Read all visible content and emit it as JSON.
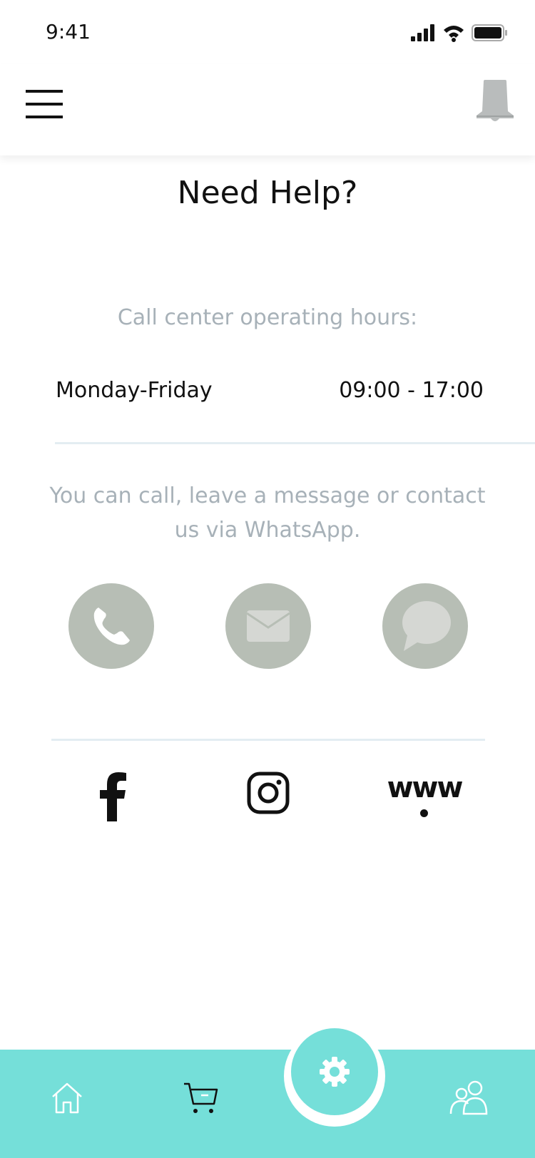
{
  "status_bar": {
    "time": "9:41"
  },
  "header": {
    "menu_icon": "hamburger-menu-icon",
    "bell_icon": "bell-icon"
  },
  "page": {
    "title": "Need Help?",
    "hours_caption": "Call center operating hours:",
    "hours": {
      "days": "Monday-Friday",
      "time": "09:00 - 17:00"
    },
    "contact_note": "You can call, leave a message or contact us via WhatsApp."
  },
  "contact_buttons": [
    {
      "icon": "phone-icon"
    },
    {
      "icon": "mail-icon"
    },
    {
      "icon": "chat-bubble-icon"
    }
  ],
  "social": {
    "facebook_icon": "facebook-icon",
    "instagram_icon": "instagram-icon",
    "www_label": "www"
  },
  "bottom_nav": {
    "items": [
      {
        "icon": "home-icon"
      },
      {
        "icon": "cart-icon"
      },
      {
        "icon": "settings-gear-icon",
        "active": true
      },
      {
        "icon": "users-icon"
      }
    ]
  },
  "colors": {
    "accent": "#75dfd9",
    "contact_circle": "#b7beb5",
    "muted_text": "#a7b1b8",
    "divider": "#e3edf2"
  }
}
